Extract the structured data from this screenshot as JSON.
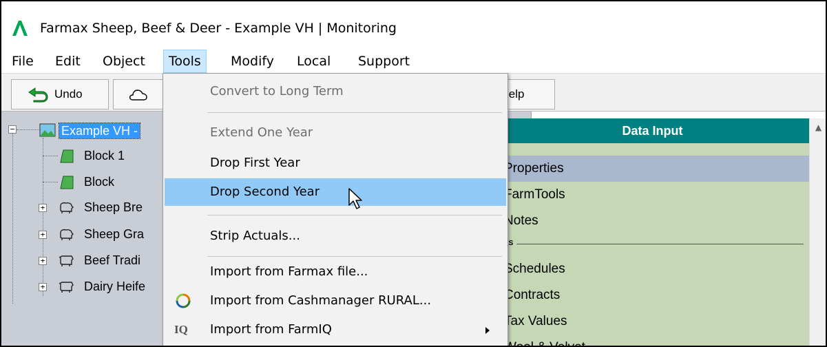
{
  "window": {
    "title": "Farmax Sheep, Beef & Deer - Example VH | Monitoring",
    "accent": "#00a651"
  },
  "menubar": {
    "items": [
      "File",
      "Edit",
      "Object",
      "Tools",
      "Modify",
      "Local",
      "Support"
    ],
    "active": "Tools"
  },
  "toolbar": {
    "undo_label": "Undo",
    "undo_icon": "undo-icon",
    "cloud_icon": "cloud-icon",
    "help_label": "lelp"
  },
  "tree": {
    "root_label": "Example VH -",
    "items": [
      {
        "label": "Block 1",
        "icon": "block-icon"
      },
      {
        "label": "Block",
        "icon": "block-icon"
      },
      {
        "label": "Sheep Bre",
        "icon": "sheep-icon"
      },
      {
        "label": "Sheep Gra",
        "icon": "sheep-icon"
      },
      {
        "label": "Beef Tradi",
        "icon": "cow-icon"
      },
      {
        "label": "Dairy Heife",
        "icon": "cow-icon"
      }
    ]
  },
  "data_panel": {
    "header": "Data Input",
    "rows": [
      "Properties",
      "FarmTools",
      "Notes"
    ],
    "separator_label": "ES",
    "rows2": [
      "Schedules",
      "Contracts",
      "Tax Values",
      "Wool & Velvet"
    ],
    "colors": {
      "header": "#008080",
      "row": "#c5d7b5",
      "selected": "#a9b8cf"
    }
  },
  "tools_menu": {
    "items": [
      {
        "label": "Convert to Long Term",
        "disabled": true
      },
      {
        "label": "Extend One Year",
        "disabled": true
      },
      {
        "label": "Drop First Year",
        "disabled": false
      },
      {
        "label": "Drop Second Year",
        "disabled": false,
        "hover": true
      },
      {
        "label": "Strip Actuals...",
        "disabled": false
      },
      {
        "label": "Import from Farmax file...",
        "disabled": false
      },
      {
        "label": "Import from Cashmanager RURAL...",
        "disabled": false,
        "icon": "cashmanager-icon"
      },
      {
        "label": "Import from FarmIQ",
        "disabled": false,
        "icon_text": "IQ",
        "submenu": true
      }
    ],
    "hover_color": "#91c9f7"
  }
}
